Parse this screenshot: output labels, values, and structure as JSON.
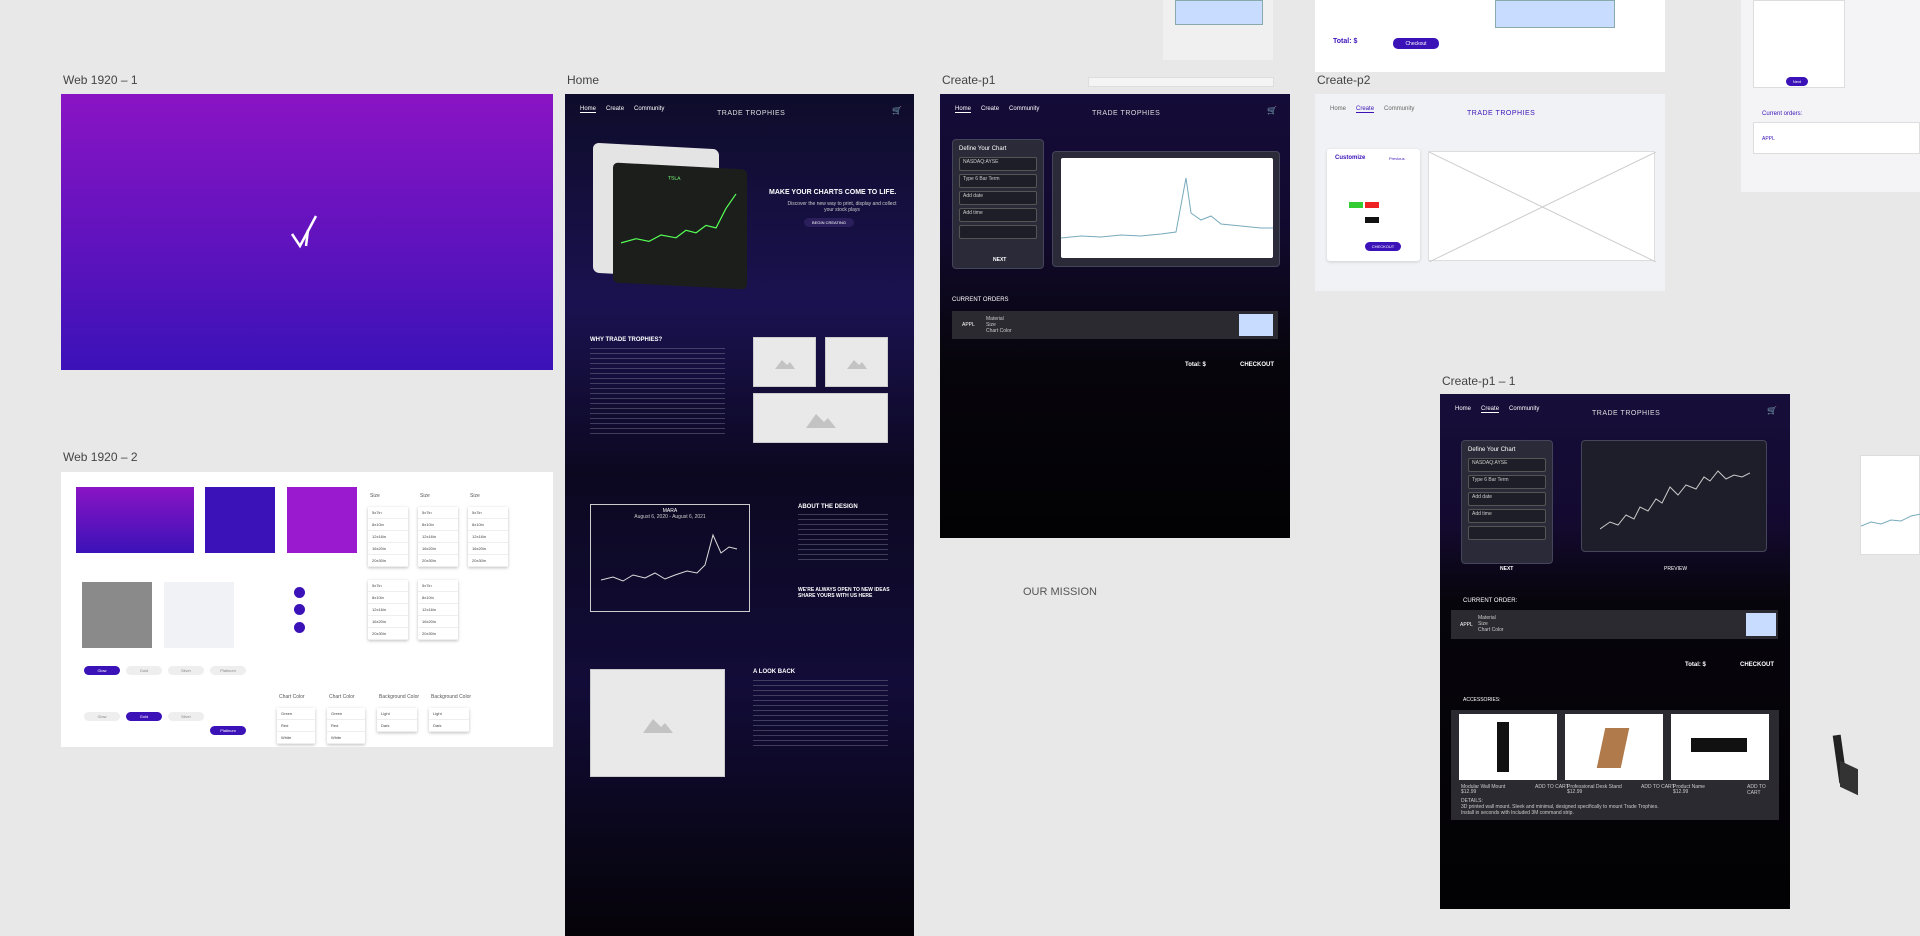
{
  "labels": {
    "web1": "Web 1920 – 1",
    "web2": "Web 1920 – 2",
    "home": "Home",
    "create1": "Create-p1",
    "create2": "Create-p2",
    "create11": "Create-p1 – 1"
  },
  "colors": {
    "canvas": "#e8e8e8",
    "purple_top": "#8a14c4",
    "purple_bottom": "#3b12b8",
    "dark_bg": "#0b0614",
    "accent": "#4a1ab5",
    "light_blue": "#c8dcff"
  },
  "nav": {
    "home": "Home",
    "create": "Create",
    "community": "Community"
  },
  "brand": "TRADE TROPHIES",
  "home": {
    "hero_title": "MAKE YOUR CHARTS COME TO LIFE.",
    "hero_sub": "Discover the new way to print, display and collect your stock plays",
    "hero_button": "BEGIN CREATING",
    "why_title": "WHY TRADE TROPHIES?",
    "about_title": "ABOUT THE DESIGN",
    "ideas_text": "WE'RE ALWAYS OPEN TO NEW IDEAS SHARE YOURS WITH US HERE",
    "lookback_title": "A LOOK BACK",
    "mara_title": "MARA",
    "mara_range": "August 6, 2020 - August 6, 2021",
    "mission": "OUR MISSION",
    "screen_ticker": "TSLA"
  },
  "create": {
    "define": "Define Your Chart",
    "ticker_value": "NASDAQ:AYSE",
    "title_placeholder": "Type 6 Bar Term",
    "begin_label": "Add date",
    "end_label": "Add time",
    "next": "NEXT",
    "current_orders": "CURRENT ORDERS",
    "current_order": "CURRENT ORDER:",
    "order_ticker": "APPL",
    "order_details": [
      "Material",
      "Size",
      "Chart Color",
      "Background Color"
    ],
    "total": "Total: $",
    "checkout": "CHECKOUT",
    "preview": "PREVIEW",
    "accessories": "ACCESSORIES:",
    "acc_items": [
      {
        "name": "Modular Wall Mount",
        "price": "$12.99",
        "action": "ADD TO CART"
      },
      {
        "name": "Professional Desk Stand",
        "price": "$12.99",
        "action": "ADD TO CART"
      },
      {
        "name": "Product Name",
        "price": "$12.99",
        "action": "ADD TO CART"
      }
    ],
    "details": "DETAILS:",
    "details_text": "3D printed wall mount. Sleek and minimal, designed specifically to mount Trade Trophies. Install in seconds with Included 3M command strip."
  },
  "create2": {
    "customize": "Customize",
    "previous": "Previous",
    "checkout": "CHECKOUT"
  },
  "topright": {
    "total": "Total: $",
    "checkout": "Checkout",
    "current_orders": "Current orders:",
    "order_ticker": "APPL",
    "next": "Next"
  },
  "style_guide": {
    "size_title": "Size",
    "sizes": [
      "5x7in",
      "8x10in",
      "12x16in",
      "16x20in",
      "20x30in"
    ],
    "chart_color": "Chart Color",
    "bg_color": "Background Color",
    "material_pills": [
      "Glow",
      "Gold",
      "Silver",
      "Platinum"
    ],
    "chart_colors": [
      "Green",
      "Red",
      "White"
    ],
    "bg_colors": [
      "Light",
      "Dark"
    ]
  }
}
